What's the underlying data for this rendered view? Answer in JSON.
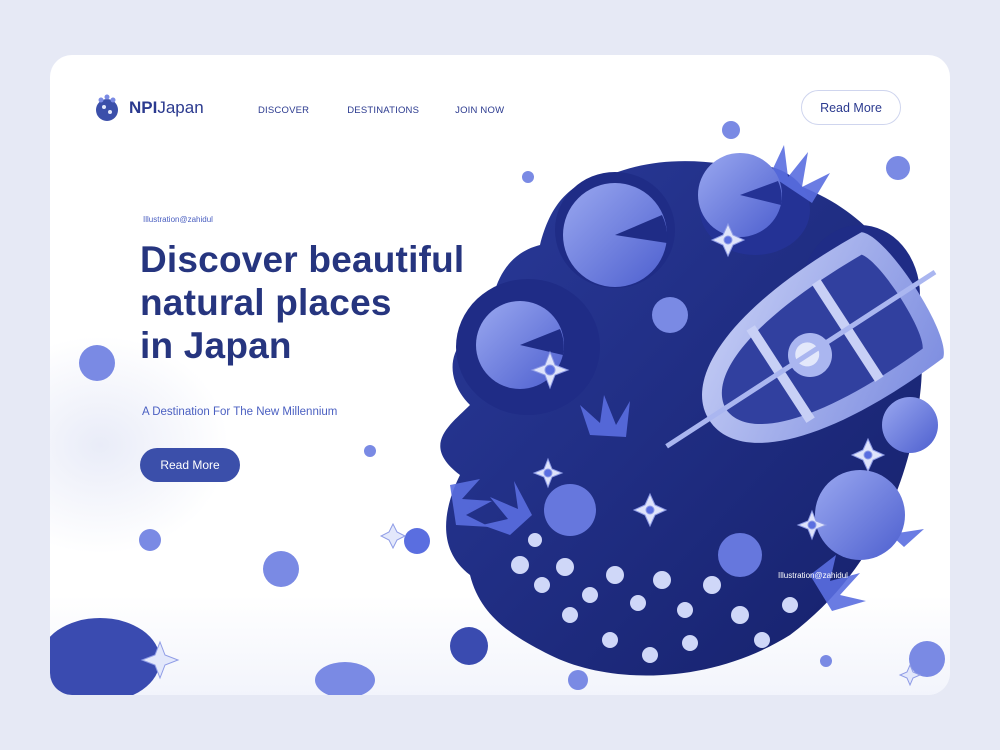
{
  "brand": {
    "bold": "NPI",
    "light": "Japan"
  },
  "nav": {
    "discover": "DISCOVER",
    "destinations": "DESTINATIONS",
    "join": "JOIN NOW"
  },
  "header": {
    "cta_label": "Read More"
  },
  "hero": {
    "credit": "Illustration@zahidul",
    "title_lines": [
      "Discover beautiful",
      "natural places",
      "in Japan"
    ],
    "subtitle": "A Destination For The New Millennium",
    "cta_label": "Read More"
  },
  "illustration": {
    "credit": "Illustration@zahidul"
  },
  "colors": {
    "page_bg": "#e6e9f5",
    "navy": "#26357f",
    "accent": "#3b4faa",
    "pond": "#1e2c80"
  },
  "icons": [
    "flower-logo-icon",
    "lily-pad-icon",
    "lotus-flower-icon",
    "rowboat-icon"
  ]
}
